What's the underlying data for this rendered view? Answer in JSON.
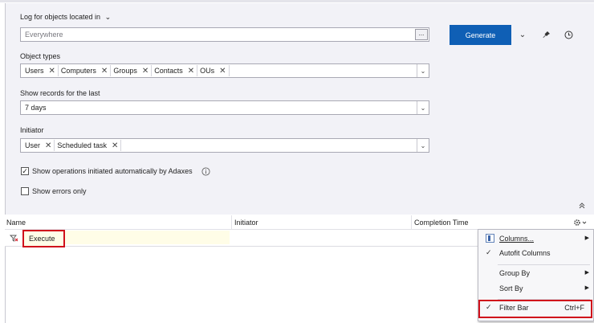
{
  "header": {
    "log_for_label": "Log for objects located in",
    "location_placeholder": "Everywhere",
    "browse_label": "...",
    "generate_label": "Generate"
  },
  "object_types": {
    "label": "Object types",
    "tags": [
      "Users",
      "Computers",
      "Groups",
      "Contacts",
      "OUs"
    ]
  },
  "period": {
    "label": "Show records for the last",
    "value": "7 days"
  },
  "initiator": {
    "label": "Initiator",
    "tags": [
      "User",
      "Scheduled task"
    ]
  },
  "options": {
    "auto_ops_label": "Show operations initiated automatically by Adaxes",
    "auto_ops_checked": true,
    "errors_only_label": "Show errors only",
    "errors_only_checked": false
  },
  "grid": {
    "columns": [
      "Name",
      "Initiator",
      "Completion Time"
    ],
    "filter_value": "Execute"
  },
  "context_menu": {
    "items": [
      {
        "label": "Columns...",
        "submenu": true
      },
      {
        "label": "Autofit Columns",
        "checked": true
      },
      {
        "label": "Group By",
        "submenu": true
      },
      {
        "label": "Sort By",
        "submenu": true
      },
      {
        "label": "Filter Bar",
        "shortcut": "Ctrl+F",
        "checked": true
      }
    ]
  },
  "icons": {
    "chevron": "chevron-down-icon",
    "pin": "pin-icon",
    "clock": "clock-icon",
    "info": "info-icon",
    "collapse": "double-chevron-up-icon",
    "gear": "gear-icon",
    "filter": "filter-clear-icon"
  },
  "colors": {
    "accent": "#0f5fb5",
    "highlight": "#d0101b",
    "filter_bg": "#fffde7"
  }
}
